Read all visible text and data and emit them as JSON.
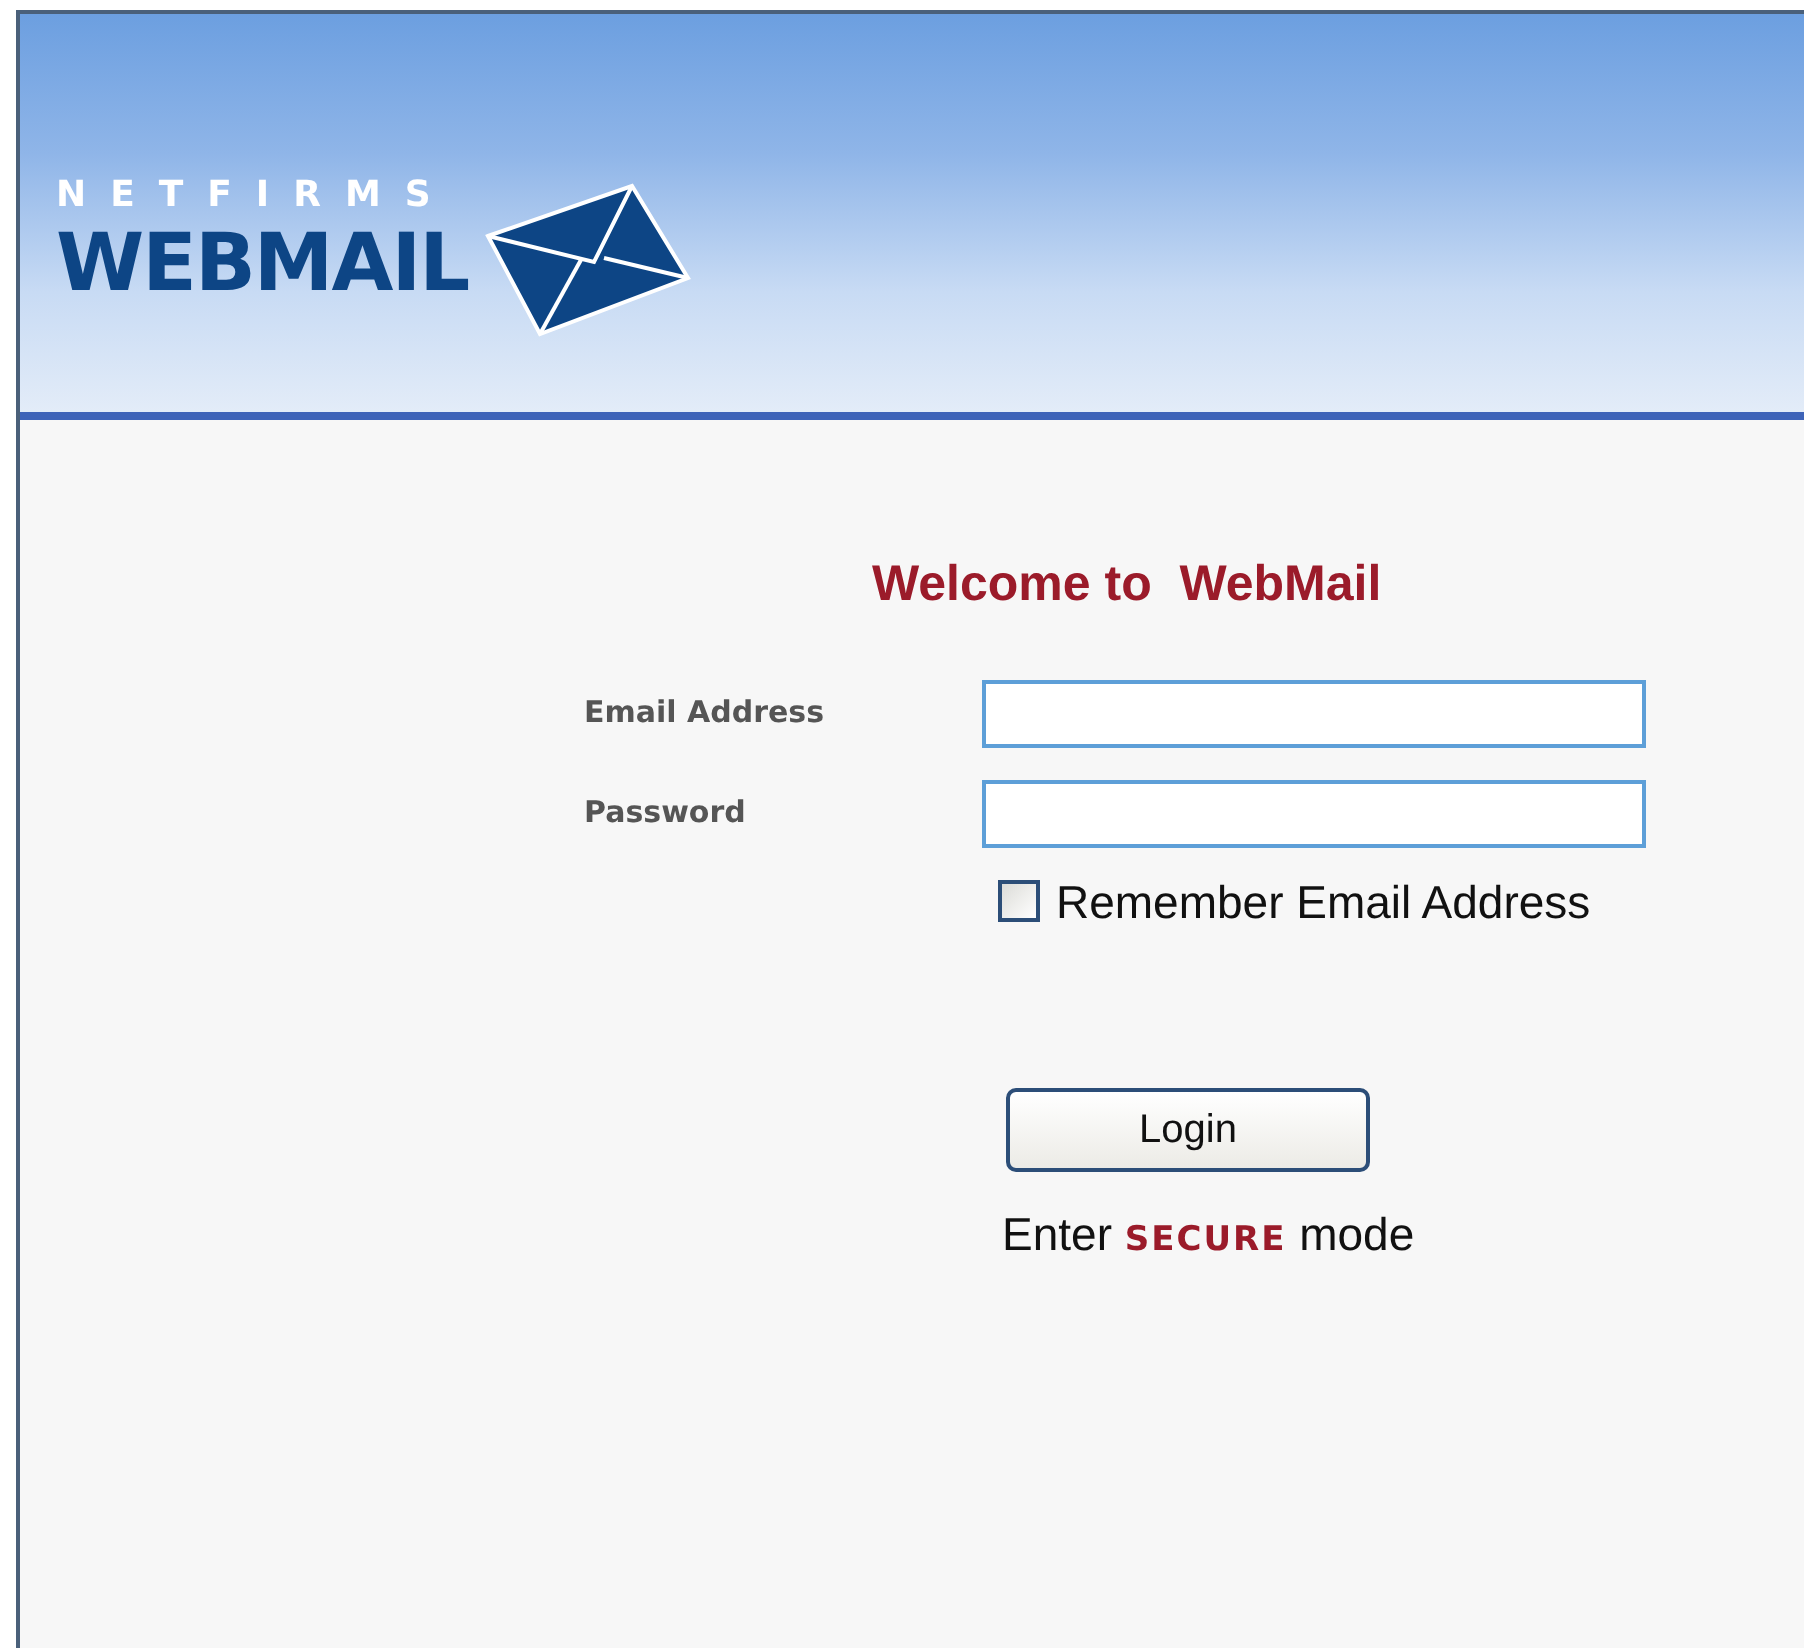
{
  "header": {
    "brand_top": "NETFIRMS",
    "brand_main": "WEBMAIL"
  },
  "login": {
    "title": "Welcome to  WebMail",
    "fields": [
      {
        "label": "Email Address"
      },
      {
        "label": "Password"
      }
    ],
    "remember": {
      "label": "Remember Email Address",
      "checked": false
    },
    "button": "Login",
    "secure_note": "Enter **SECURE** mode"
  }
}
